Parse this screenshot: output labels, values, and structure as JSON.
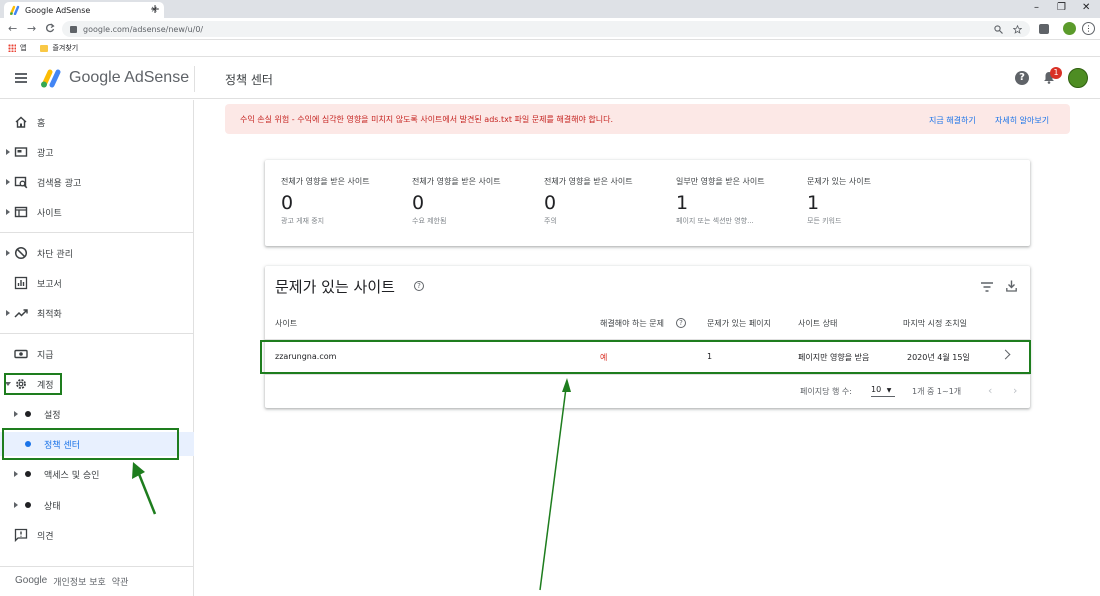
{
  "browser": {
    "tab_title": "Google AdSense",
    "tab_close": "×",
    "new_tab": "+",
    "win_min": "–",
    "win_max": "❐",
    "win_close": "✕",
    "back": "←",
    "forward": "→",
    "reload": "C",
    "url": "google.com/adsense/new/u/0/",
    "bookmarks": [
      {
        "label": "앱"
      },
      {
        "label": "즐겨찾기"
      }
    ]
  },
  "header": {
    "brand": "Google AdSense",
    "title": "정책 센터",
    "help": "?",
    "notification_count": "1"
  },
  "sidebar": {
    "items": [
      {
        "label": "홈"
      },
      {
        "label": "광고"
      },
      {
        "label": "검색용 광고"
      },
      {
        "label": "사이트"
      },
      {
        "label": "차단 관리"
      },
      {
        "label": "보고서"
      },
      {
        "label": "최적화"
      },
      {
        "label": "지급"
      },
      {
        "label": "계정"
      },
      {
        "label": "설정"
      },
      {
        "label": "정책 센터"
      },
      {
        "label": "액세스 및 승인"
      },
      {
        "label": "상태"
      },
      {
        "label": "의견"
      }
    ],
    "footer": {
      "brand": "Google",
      "privacy": "개인정보 보호",
      "terms": "약관"
    }
  },
  "alert": {
    "text": "수익 손실 위험 - 수익에 심각한 영향을 미치지 않도록 사이트에서 발견된 ads.txt 파일 문제를 해결해야 합니다.",
    "fix_link": "지금 해결하기",
    "learn_link": "자세히 알아보기"
  },
  "stats": [
    {
      "title": "전체가 영향을 받은 사이트",
      "value": "0",
      "sub": "광고 게재 중지"
    },
    {
      "title": "전체가 영향을 받은 사이트",
      "value": "0",
      "sub": "수요 제한됨"
    },
    {
      "title": "전체가 영향을 받은 사이트",
      "value": "0",
      "sub": "주의"
    },
    {
      "title": "일부만 영향을 받은 사이트",
      "value": "1",
      "sub": "페이지 또는 섹션만 영향..."
    },
    {
      "title": "문제가 있는 사이트",
      "value": "1",
      "sub": "모든 키워드"
    }
  ],
  "sites": {
    "title": "문제가 있는 사이트",
    "help": "?",
    "columns": [
      "사이트",
      "해결해야 하는 문제",
      "문제가 있는 페이지",
      "사이트 상태",
      "마지막 시정 조치일"
    ],
    "rows": [
      {
        "site": "zzarungna.com",
        "must_fix": "예",
        "pages": "1",
        "status": "페이지만 영향을 받음",
        "date": "2020년 4월 15일"
      }
    ],
    "pager": {
      "rows_label": "페이지당 행 수:",
      "rows_value": "10",
      "range": "1개 중 1~1개",
      "prev": "‹",
      "next": "›"
    }
  },
  "colors": {
    "accent": "#1a73e8",
    "alert_bg": "#fce8e6",
    "alert_text": "#c5221f",
    "issue_red": "#d93025",
    "annotation_green": "#1e7d1e"
  }
}
